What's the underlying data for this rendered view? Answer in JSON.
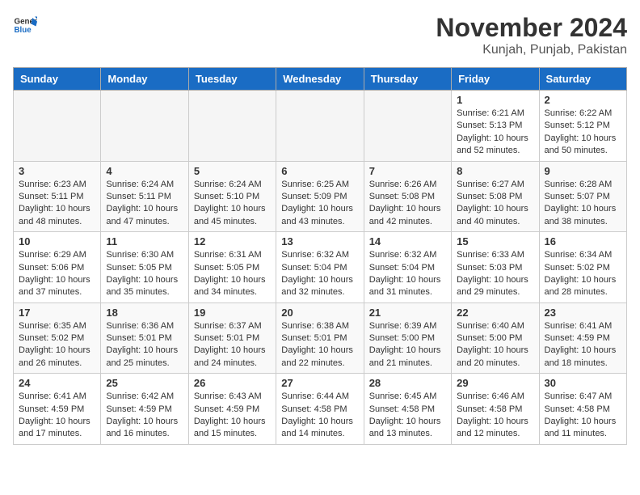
{
  "header": {
    "logo_general": "General",
    "logo_blue": "Blue",
    "month_title": "November 2024",
    "location": "Kunjah, Punjab, Pakistan"
  },
  "calendar": {
    "days_of_week": [
      "Sunday",
      "Monday",
      "Tuesday",
      "Wednesday",
      "Thursday",
      "Friday",
      "Saturday"
    ],
    "weeks": [
      [
        {
          "day": "",
          "empty": true
        },
        {
          "day": "",
          "empty": true
        },
        {
          "day": "",
          "empty": true
        },
        {
          "day": "",
          "empty": true
        },
        {
          "day": "",
          "empty": true
        },
        {
          "day": "1",
          "sunrise": "6:21 AM",
          "sunset": "5:13 PM",
          "daylight": "10 hours and 52 minutes."
        },
        {
          "day": "2",
          "sunrise": "6:22 AM",
          "sunset": "5:12 PM",
          "daylight": "10 hours and 50 minutes."
        }
      ],
      [
        {
          "day": "3",
          "sunrise": "6:23 AM",
          "sunset": "5:11 PM",
          "daylight": "10 hours and 48 minutes."
        },
        {
          "day": "4",
          "sunrise": "6:24 AM",
          "sunset": "5:11 PM",
          "daylight": "10 hours and 47 minutes."
        },
        {
          "day": "5",
          "sunrise": "6:24 AM",
          "sunset": "5:10 PM",
          "daylight": "10 hours and 45 minutes."
        },
        {
          "day": "6",
          "sunrise": "6:25 AM",
          "sunset": "5:09 PM",
          "daylight": "10 hours and 43 minutes."
        },
        {
          "day": "7",
          "sunrise": "6:26 AM",
          "sunset": "5:08 PM",
          "daylight": "10 hours and 42 minutes."
        },
        {
          "day": "8",
          "sunrise": "6:27 AM",
          "sunset": "5:08 PM",
          "daylight": "10 hours and 40 minutes."
        },
        {
          "day": "9",
          "sunrise": "6:28 AM",
          "sunset": "5:07 PM",
          "daylight": "10 hours and 38 minutes."
        }
      ],
      [
        {
          "day": "10",
          "sunrise": "6:29 AM",
          "sunset": "5:06 PM",
          "daylight": "10 hours and 37 minutes."
        },
        {
          "day": "11",
          "sunrise": "6:30 AM",
          "sunset": "5:05 PM",
          "daylight": "10 hours and 35 minutes."
        },
        {
          "day": "12",
          "sunrise": "6:31 AM",
          "sunset": "5:05 PM",
          "daylight": "10 hours and 34 minutes."
        },
        {
          "day": "13",
          "sunrise": "6:32 AM",
          "sunset": "5:04 PM",
          "daylight": "10 hours and 32 minutes."
        },
        {
          "day": "14",
          "sunrise": "6:32 AM",
          "sunset": "5:04 PM",
          "daylight": "10 hours and 31 minutes."
        },
        {
          "day": "15",
          "sunrise": "6:33 AM",
          "sunset": "5:03 PM",
          "daylight": "10 hours and 29 minutes."
        },
        {
          "day": "16",
          "sunrise": "6:34 AM",
          "sunset": "5:02 PM",
          "daylight": "10 hours and 28 minutes."
        }
      ],
      [
        {
          "day": "17",
          "sunrise": "6:35 AM",
          "sunset": "5:02 PM",
          "daylight": "10 hours and 26 minutes."
        },
        {
          "day": "18",
          "sunrise": "6:36 AM",
          "sunset": "5:01 PM",
          "daylight": "10 hours and 25 minutes."
        },
        {
          "day": "19",
          "sunrise": "6:37 AM",
          "sunset": "5:01 PM",
          "daylight": "10 hours and 24 minutes."
        },
        {
          "day": "20",
          "sunrise": "6:38 AM",
          "sunset": "5:01 PM",
          "daylight": "10 hours and 22 minutes."
        },
        {
          "day": "21",
          "sunrise": "6:39 AM",
          "sunset": "5:00 PM",
          "daylight": "10 hours and 21 minutes."
        },
        {
          "day": "22",
          "sunrise": "6:40 AM",
          "sunset": "5:00 PM",
          "daylight": "10 hours and 20 minutes."
        },
        {
          "day": "23",
          "sunrise": "6:41 AM",
          "sunset": "4:59 PM",
          "daylight": "10 hours and 18 minutes."
        }
      ],
      [
        {
          "day": "24",
          "sunrise": "6:41 AM",
          "sunset": "4:59 PM",
          "daylight": "10 hours and 17 minutes."
        },
        {
          "day": "25",
          "sunrise": "6:42 AM",
          "sunset": "4:59 PM",
          "daylight": "10 hours and 16 minutes."
        },
        {
          "day": "26",
          "sunrise": "6:43 AM",
          "sunset": "4:59 PM",
          "daylight": "10 hours and 15 minutes."
        },
        {
          "day": "27",
          "sunrise": "6:44 AM",
          "sunset": "4:58 PM",
          "daylight": "10 hours and 14 minutes."
        },
        {
          "day": "28",
          "sunrise": "6:45 AM",
          "sunset": "4:58 PM",
          "daylight": "10 hours and 13 minutes."
        },
        {
          "day": "29",
          "sunrise": "6:46 AM",
          "sunset": "4:58 PM",
          "daylight": "10 hours and 12 minutes."
        },
        {
          "day": "30",
          "sunrise": "6:47 AM",
          "sunset": "4:58 PM",
          "daylight": "10 hours and 11 minutes."
        }
      ]
    ]
  }
}
